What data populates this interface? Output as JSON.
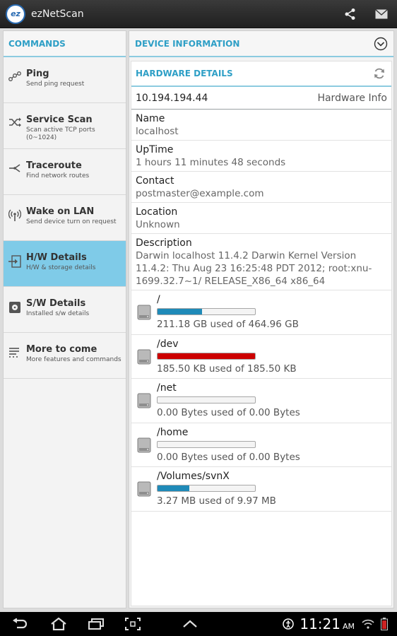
{
  "app": {
    "title": "ezNetScan",
    "logo_text": "ez"
  },
  "actionbar": {
    "share_icon": "share-icon",
    "mail_icon": "mail-icon"
  },
  "commands": {
    "header": "COMMANDS",
    "items": [
      {
        "title": "Ping",
        "subtitle": "Send ping request",
        "icon": "ping-icon",
        "active": false
      },
      {
        "title": "Service Scan",
        "subtitle": "Scan active TCP ports (0~1024)",
        "icon": "shuffle-icon",
        "active": false
      },
      {
        "title": "Traceroute",
        "subtitle": "Find network routes",
        "icon": "traceroute-icon",
        "active": false
      },
      {
        "title": "Wake on LAN",
        "subtitle": "Send device turn on request",
        "icon": "antenna-icon",
        "active": false
      },
      {
        "title": "H/W Details",
        "subtitle": "H/W & storage details",
        "icon": "hardware-icon",
        "active": true
      },
      {
        "title": "S/W Details",
        "subtitle": "Installed s/w details",
        "icon": "disc-icon",
        "active": false
      },
      {
        "title": "More to come",
        "subtitle": "More features and commands",
        "icon": "list-icon",
        "active": false
      }
    ]
  },
  "device": {
    "header": "DEVICE INFORMATION",
    "hardware_header": "HARDWARE DETAILS",
    "ip": "10.194.194.44",
    "ip_label": "Hardware Info",
    "fields": [
      {
        "key": "Name",
        "value": "localhost"
      },
      {
        "key": "UpTime",
        "value": "1 hours 11 minutes 48 seconds"
      },
      {
        "key": "Contact",
        "value": "postmaster@example.com"
      },
      {
        "key": "Location",
        "value": "Unknown"
      },
      {
        "key": "Description",
        "value": "Darwin localhost 11.4.2 Darwin Kernel Version 11.4.2: Thu Aug 23 16:25:48 PDT 2012; root:xnu-1699.32.7~1/ RELEASE_X86_64 x86_64"
      }
    ],
    "disks": [
      {
        "mount": "/",
        "usage": "211.18 GB used of 464.96 GB",
        "fraction": 0.454,
        "color": "#1f8ab8"
      },
      {
        "mount": "/dev",
        "usage": "185.50 KB used of 185.50 KB",
        "fraction": 1.0,
        "color": "#cc0000"
      },
      {
        "mount": "/net",
        "usage": "0.00 Bytes used of 0.00 Bytes",
        "fraction": 0,
        "color": "#1f8ab8"
      },
      {
        "mount": "/home",
        "usage": "0.00 Bytes used of 0.00 Bytes",
        "fraction": 0,
        "color": "#1f8ab8"
      },
      {
        "mount": "/Volumes/svnX",
        "usage": "3.27 MB used of 9.97 MB",
        "fraction": 0.328,
        "color": "#1f8ab8"
      }
    ]
  },
  "statusbar": {
    "time": "11:21",
    "ampm": "AM"
  },
  "colors": {
    "accent": "#2e9fc6",
    "active_bg": "#7fcbe8",
    "actionbar": "#2b2b2b"
  }
}
